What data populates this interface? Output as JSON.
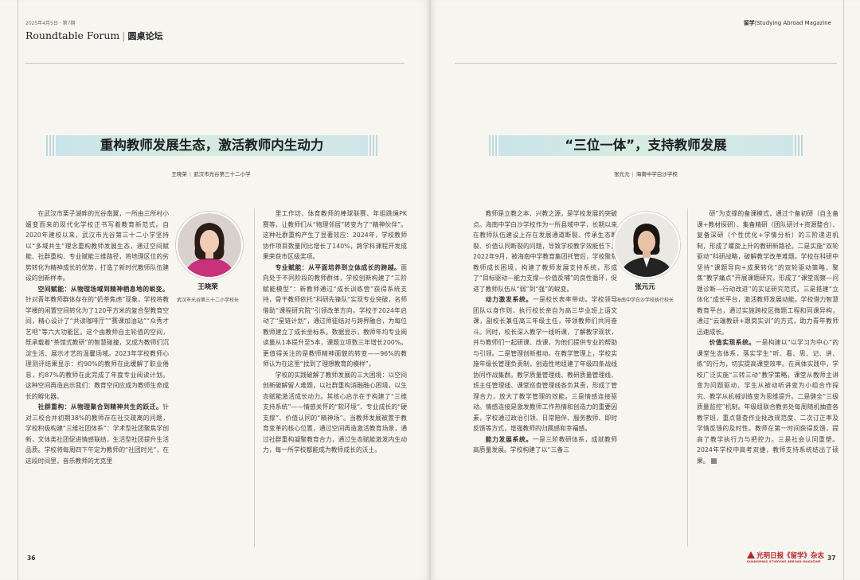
{
  "header": {
    "issue": "2025年4月5日 · 第7期",
    "section_en": "Roundtable Forum",
    "section_cn": "圆桌论坛",
    "magazine": "Studying Abroad Magazine",
    "magazine_logo": "留学"
  },
  "left_article": {
    "title": "重构教师发展生态，激活教师内生动力",
    "author": "王晓荣",
    "affiliation": "武汉市光谷第三十二小学",
    "photo_name": "王晓荣",
    "photo_role": "武汉市光谷第三十二小学校长",
    "col1": [
      {
        "sub": "",
        "text": "在武汉市栗子湖畔的光谷南翼，一所由三所村小嬗变而来的现代化学校正书写着教育新范式。自2020年建校以来，武汉市光谷第三十二小学坚持以“多域共生”理念重构教师发展生态，通过空间赋能、社群重构、专业赋能三维路径，将地理区位的劣势转化为精神成长的优势，打造了新时代教师队伍建设的创新样本。"
      },
      {
        "sub": "空间赋能：从物理场域到精神栖息地的蜕变。",
        "text": "针对青年教师群体存在的“奶茶焦虑”现象，学校将教学楼的闲置空间转化为了120平方米的复合型教育空间，精心设计了“共读咖啡厅”“赛课加油站”“众秀才艺吧”等六大功能区。这个由教师自主轮值的空间，既承载着“茶馆式教研”的智慧碰撞，又成为教师们沉淀生活、展示才艺的温馨场域。2023年学校教师心理测评结果显示：约90%的教师在此缓解了职业倦怠，约87%的教师在此完成了年度专业阅读计划。这种空间再造启示我们：教育空间应成为教师生命成长的孵化器。"
      },
      {
        "sub": "社群重构：从物理聚合到精神共生的跃迁。",
        "text": "针对三校合并初期38%的教师存在社交疏离的问题，学校积极构建“三维社团体系”：学术型社团聚焦学创新，文体类社团促进情感联结，生活型社团提升生活品质。学校将每周四下午定为教师的“社团时光”，在这段时间里，音乐教师的尤克里"
      }
    ],
    "col2": [
      {
        "sub": "",
        "text": "里工作坊、体育教师的棒球联赛、年组跳绳PK赛等，让教师们从“物理邻居”转变为了“精神伙伴”。这种社群重构产生了显著效应：2024年，学校教师协作项目数量同比增长了140%，跨学科课程开发成果荣获市区级奖项。"
      },
      {
        "sub": "专业赋能：从平面培养到立体成长的跨越。",
        "text": "面向处于不同阶段的教师群体，学校创新构建了“三阶赋能模型”：新教师通过“成长训练营”获得系统支持，骨干教师依托“科研先锋队”实现专业突破，名师借助“课程研究院”引领改革方向。学校于2024年启动了“星链计划”，通过师徒结对与跨界融合，为每位教师建立了成长坐标系。数据显示，教师年均专业阅读量从1本提升至5本，课题立项数三年增长200%。更值得关注的是教师精神面貌的转变——96%的教师认为在这里“找到了理想教育的模样”。"
      },
      {
        "sub": "",
        "text": "学校的实践破解了教师发展的三大困境：以空间创新破解留人难题，以社群重构消融融心困境，以生态赋能激活成长动力。其核心启示在于构建了“三维支持系统”——情感关怀的“软环境”、专业成长的“硬支撑”、价值认同的“精神场”。当教师发展被置于教育变革的核心位置，通过空间再造激活教育场景，通过社群重构凝聚教育合力，通过生态赋能激发内生动力，每一所学校都能成为教师成长的沃土。"
      }
    ]
  },
  "right_article": {
    "title": "“三位一体”，支持教师发展",
    "author": "张元元",
    "affiliation": "海南中学白沙学校",
    "photo_name": "张元元",
    "photo_role": "海南中学白沙学校执行校长",
    "col1": [
      {
        "sub": "",
        "text": "教师是立教之本、兴教之源，是学校发展的突破点。海南中学白沙学校作为一所县域中学，长期以来在教师队伍建设上存在发展通道断裂、传承生态断裂、价值认同断裂的问题，导致学校教学效能低下。2022年9月，被海南中学教育集团托管后，学校聚焦教师成长困境，构建了教师发展支持系统，形成了“目标驱动—能力支撑—价值反哺”的良性循环，促进了教师队伍从“弱”到“强”的蜕变。"
      },
      {
        "sub": "动力激发系统。",
        "text": "一是校长表率带动。学校领导团队以身作则，执行校长亲自为高三毕业班上语文课，副校长兼任高三年级主任，带领教师们共同奋斗。同时，校长深入教学一线听课，了解教学现状，并与教师们一起研课、改课，为他们提供专业的帮助与引领。二是管理创新推动。在教学管理上，学校实施年级长管理负责制，创造性地组建了年级四条战线协同作战集群。教学质量管理线、教研质量管理线、班主任管理线、课堂巡查管理线各负其责，形成了管理合力，放大了教学管理的效能。三是情感连接驱动。情感连接是激发教师工作热情和创造力的重要因素，学校通过政治引领、日常陪伴、服务教师、即时反馈等方式，增强教师的归属感和幸福感。"
      },
      {
        "sub": "能力发展系统。",
        "text": "一是三阶教研体系，成就教师高质量发展。学校构建了以“三备三"
      }
    ],
    "col2": [
      {
        "sub": "",
        "text": "研”为支撑的备课模式，通过个备初研（自主备课+教材探研）、集备精研（团队研讨+资源整合）、复备深研（个性优化+学情分析）的三阶递进机制，形成了螺旋上升的教研新路径。二是实施“双轮驱动”科研战略，破解教学改革难题。学校在科研中坚持“课题导向+成果转化”的双轮驱动策略，聚焦“教学痛点”开展课题研究，形成了“课堂观察—问题诊断—行动改进”的实证研究范式。三是搭建“立体化”成长平台，激活教师发展动能。学校借力智慧教育平台，通过实施跨校区微题工程和同课异构，通过“云端教研+跟岗实训”的方式，助力青年教师迅速成长。"
      },
      {
        "sub": "价值实现系统。",
        "text": "一是构建以“以学习为中心”的课堂生态体系，落实学生“听、看、思、记、讲、练”的行为，切实提高课堂效率。在具体实践中，学校广泛实施“三转三动”教学策略，课堂从教师主讲变为问题驱动、学生从被动听讲变为小组合作探究、教学从机械训练变为思维提升。二是健全“三级质量监控”机制。年级组联合教务处每周随机抽查各教学班，重点督查作业批改规范度、二次订正率及学情反馈的及时性。教师在第一时间获得反馈，提高了教学执行力与把控力。三是社会认同重塑。2024年学校中高考双捷，教师支持系统结出了硕果。"
      }
    ]
  },
  "footer": {
    "left_page": "36",
    "right_page": "37",
    "logo_cn": "光明日报《留学》杂志",
    "logo_en": "GUANGMING STUDYING ABROAD MAGAZINE"
  },
  "colors": {
    "title_band": "#cfe6e8",
    "accent": "#b3282d"
  },
  "icons": [
    "portrait-photo",
    "magazine-logo-icon",
    "end-mark-icon"
  ]
}
